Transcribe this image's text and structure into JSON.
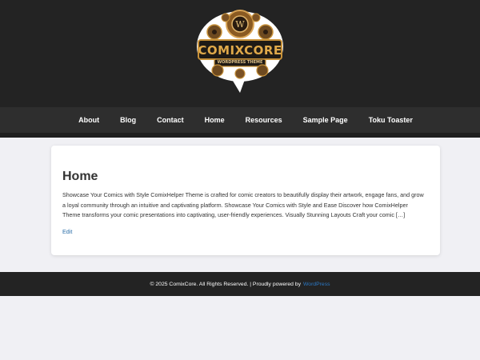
{
  "header": {
    "logo_text": "COMIXCORE",
    "logo_subtitle": "WORDPRESS THEME"
  },
  "nav": {
    "items": [
      {
        "label": "About"
      },
      {
        "label": "Blog"
      },
      {
        "label": "Contact"
      },
      {
        "label": "Home"
      },
      {
        "label": "Resources"
      },
      {
        "label": "Sample Page"
      },
      {
        "label": "Toku Toaster"
      }
    ]
  },
  "main": {
    "title": "Home",
    "excerpt": "Showcase Your Comics with Style ComixHelper Theme is crafted for comic creators to beautifully display their artwork, engage fans, and grow a loyal community through an intuitive and captivating platform. Showcase Your Comics with Style and Ease Discover how ComixHelper Theme transforms your comic presentations into captivating, user-friendly experiences. Visually Stunning Layouts Craft your comic […]",
    "edit_label": "Edit"
  },
  "footer": {
    "text": "© 2025 ComixCore. All Rights Reserved. | Proudly powered by",
    "link": "WordPress"
  },
  "colors": {
    "header_bg": "#232323",
    "nav_bg": "#2e2e2e",
    "link": "#2b6ea8",
    "logo_gold": "#c8923a"
  }
}
